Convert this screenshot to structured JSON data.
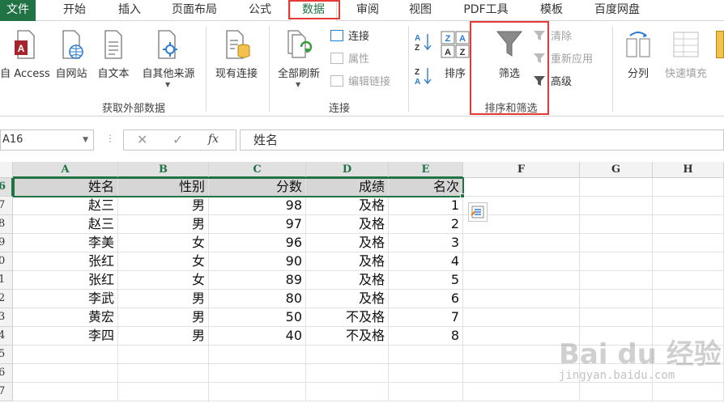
{
  "tabs": [
    {
      "label": "文件",
      "state": "file"
    },
    {
      "label": "开始"
    },
    {
      "label": "插入"
    },
    {
      "label": "页面布局"
    },
    {
      "label": "公式"
    },
    {
      "label": "数据",
      "state": "active"
    },
    {
      "label": "审阅"
    },
    {
      "label": "视图"
    },
    {
      "label": "PDF工具"
    },
    {
      "label": "模板"
    },
    {
      "label": "百度网盘"
    }
  ],
  "ribbon": {
    "external": {
      "access": "自 Access",
      "web": "自网站",
      "text": "自文本",
      "other": "自其他来源",
      "existing": "现有连接",
      "group": "获取外部数据"
    },
    "connections": {
      "refresh_all": "全部刷新",
      "connect": "连接",
      "properties": "属性",
      "edit_links": "编辑链接",
      "group": "连接"
    },
    "sort_filter": {
      "sort": "排序",
      "filter": "筛选",
      "clear": "清除",
      "reapply": "重新应用",
      "advanced": "高级",
      "group": "排序和筛选"
    },
    "tools": {
      "split": "分列",
      "flash_fill": "快速填充"
    }
  },
  "formula_bar": {
    "name_box": "A16",
    "fx": "fx",
    "content": "姓名"
  },
  "sheet": {
    "columns": [
      "A",
      "B",
      "C",
      "D",
      "E",
      "F",
      "G",
      "H"
    ],
    "row_labels": [
      "6",
      "7",
      "8",
      "9",
      "0",
      "1",
      "2",
      "3",
      "4",
      "5",
      "6",
      "7"
    ],
    "header_row": [
      "姓名",
      "性别",
      "分数",
      "成绩",
      "名次"
    ],
    "rows": [
      [
        "赵三",
        "男",
        "98",
        "及格",
        "1"
      ],
      [
        "赵三",
        "男",
        "97",
        "及格",
        "2"
      ],
      [
        "李美",
        "女",
        "96",
        "及格",
        "3"
      ],
      [
        "张红",
        "女",
        "90",
        "及格",
        "4"
      ],
      [
        "张红",
        "女",
        "89",
        "及格",
        "5"
      ],
      [
        "李武",
        "男",
        "80",
        "及格",
        "6"
      ],
      [
        "黄宏",
        "男",
        "50",
        "不及格",
        "7"
      ],
      [
        "李四",
        "男",
        "40",
        "不及格",
        "8"
      ]
    ]
  },
  "watermark": {
    "brand": "Bai du 经验",
    "url": "jingyan.baidu.com"
  },
  "colors": {
    "accent": "#217346",
    "highlight_box": "#e53935"
  }
}
